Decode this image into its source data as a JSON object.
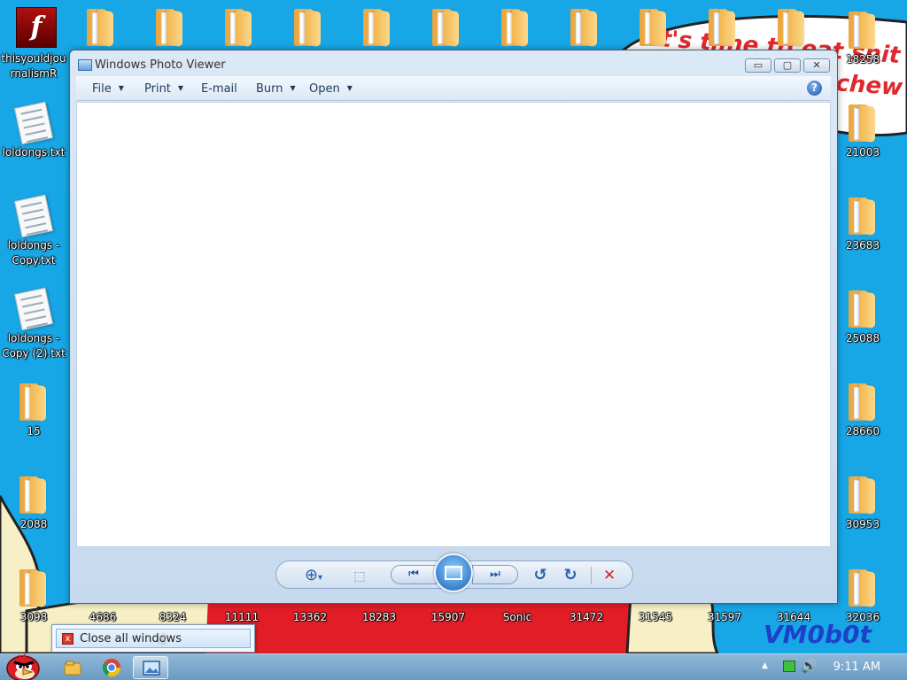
{
  "desktop": {
    "left_icons": [
      {
        "label": "thisyouldjournalismR",
        "type": "flash"
      },
      {
        "label": "loldongs.txt",
        "type": "txt"
      },
      {
        "label": "loldongs - Copy.txt",
        "type": "txt"
      },
      {
        "label": "loldongs - Copy (2).txt",
        "type": "txt"
      },
      {
        "label": "15",
        "type": "folder"
      },
      {
        "label": "2088",
        "type": "folder"
      },
      {
        "label": "3098",
        "type": "folder"
      }
    ],
    "right_icons": [
      {
        "label": "18258",
        "type": "folder"
      },
      {
        "label": "21003",
        "type": "folder"
      },
      {
        "label": "23683",
        "type": "folder"
      },
      {
        "label": "25088",
        "type": "folder"
      },
      {
        "label": "28660",
        "type": "folder"
      },
      {
        "label": "30953",
        "type": "folder"
      },
      {
        "label": "32036",
        "type": "folder"
      }
    ],
    "bottom_labels": [
      "4686",
      "8324",
      "11111",
      "13362",
      "18283",
      "15907",
      "Sonic",
      "31472",
      "31545",
      "31597",
      "31644"
    ],
    "wallpaper_text": {
      "graffiti_line1": "it's time to eat shit",
      "graffiti_line2": "chew",
      "signature": "VM0b0t"
    }
  },
  "window": {
    "title": "Windows Photo Viewer",
    "caption_buttons": {
      "minimize": "▭",
      "maximize": "▢",
      "close": "✕"
    },
    "menu": [
      {
        "label": "File",
        "has_arrow": true
      },
      {
        "label": "Print",
        "has_arrow": true
      },
      {
        "label": "E-mail",
        "has_arrow": false
      },
      {
        "label": "Burn",
        "has_arrow": true
      },
      {
        "label": "Open",
        "has_arrow": true
      }
    ],
    "help_label": "?",
    "controls": {
      "zoom": "⊕",
      "zoom_arrow": "▾",
      "fit": "⬚",
      "prev": "⏮",
      "next": "⏭",
      "rotate_ccw": "↺",
      "rotate_cw": "↻",
      "delete": "✕"
    }
  },
  "jumplist": {
    "close_all_label": "Close all windows"
  },
  "taskbar": {
    "clock": "9:11 AM",
    "tray_arrow": "▲",
    "volume_icon": "🔊"
  },
  "colors": {
    "sky": "#17a7e7",
    "red": "#e21d25",
    "cream": "#f7efc6",
    "taskbar": "#7ba7cf",
    "accent_blue": "#1b5fb6"
  }
}
